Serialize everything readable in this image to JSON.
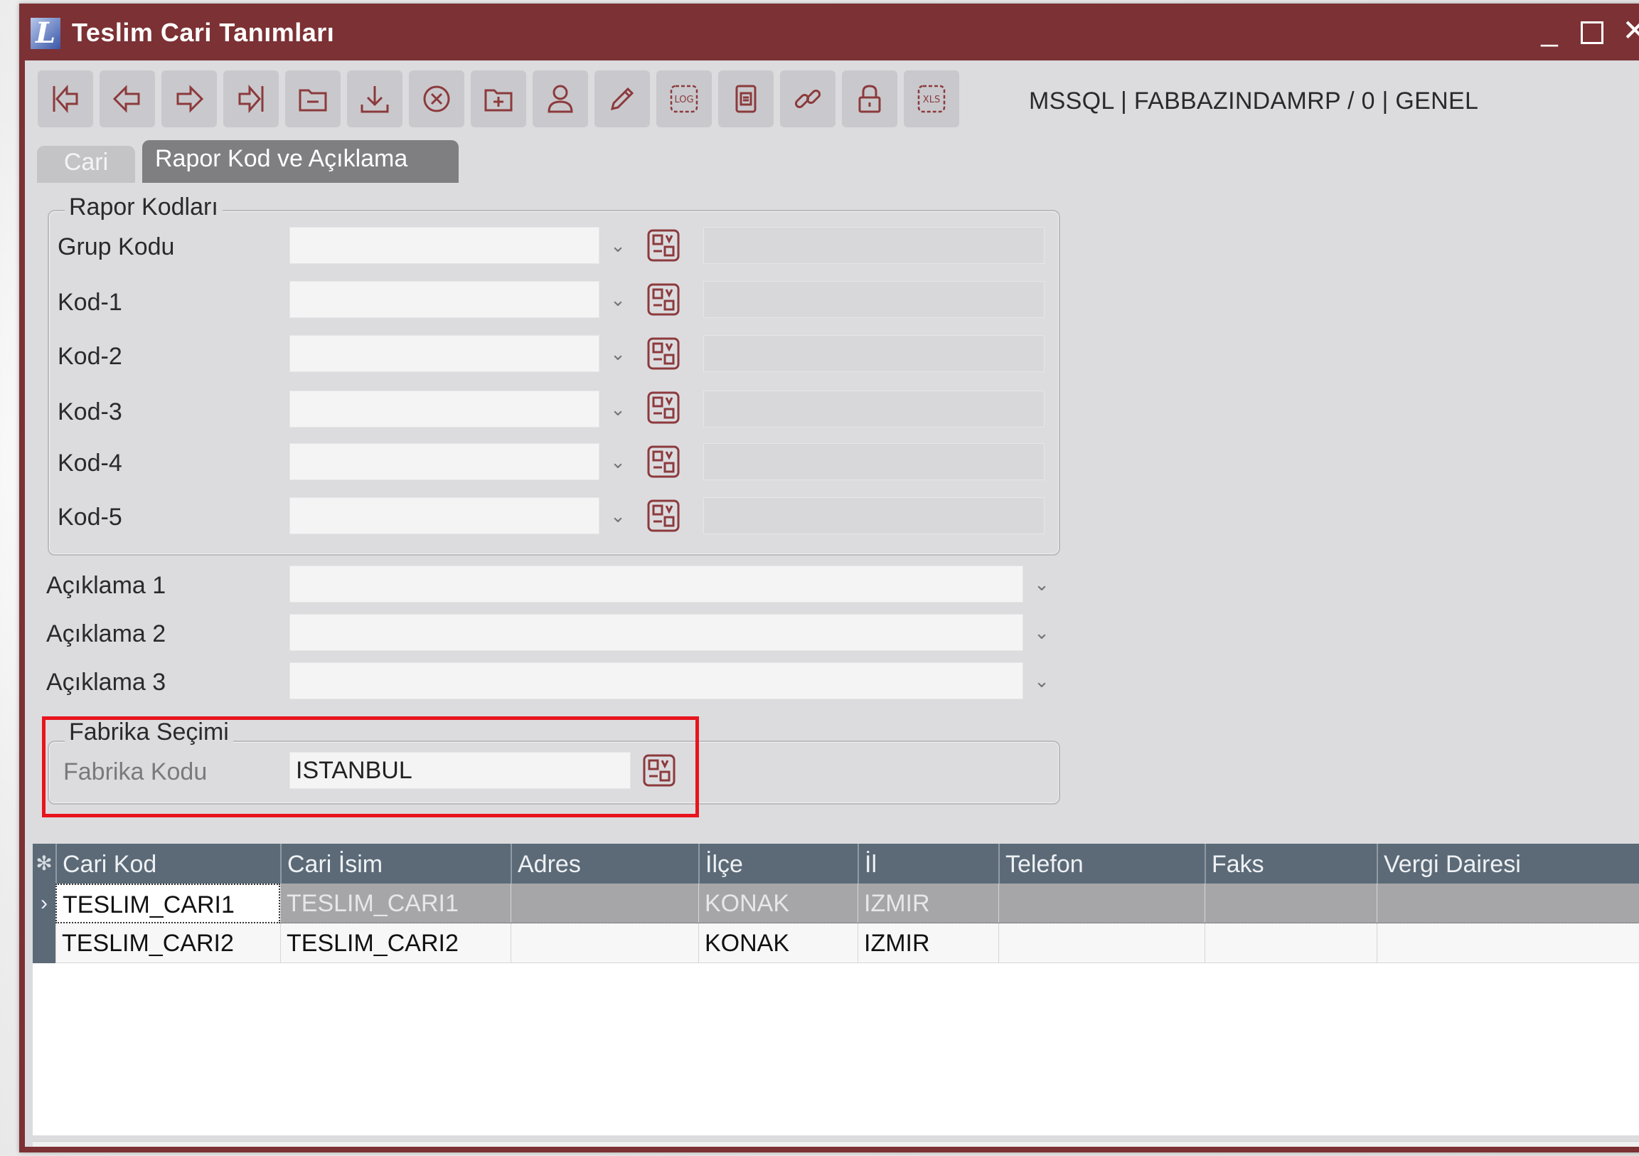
{
  "window": {
    "title": "Teslim Cari Tanımları"
  },
  "toolbar": {
    "buttons": [
      {
        "name": "first-record-button",
        "icon": "first-icon"
      },
      {
        "name": "previous-record-button",
        "icon": "prev-icon"
      },
      {
        "name": "next-record-button",
        "icon": "next-icon"
      },
      {
        "name": "last-record-button",
        "icon": "last-icon"
      },
      {
        "name": "new-record-button",
        "icon": "folder-icon"
      },
      {
        "name": "save-button",
        "icon": "download-icon"
      },
      {
        "name": "delete-button",
        "icon": "cancel-circle-icon"
      },
      {
        "name": "copy-button",
        "icon": "folder-plus-icon"
      },
      {
        "name": "user-button",
        "icon": "user-icon"
      },
      {
        "name": "edit-button",
        "icon": "pencil-icon"
      },
      {
        "name": "log-button",
        "icon": "log-icon",
        "label": "LOG"
      },
      {
        "name": "document-button",
        "icon": "document-icon"
      },
      {
        "name": "link-button",
        "icon": "link-icon"
      },
      {
        "name": "lock-button",
        "icon": "lock-icon"
      },
      {
        "name": "excel-button",
        "icon": "xls-icon",
        "label": "XLS"
      }
    ],
    "connection_info": "MSSQL | FABBAZINDAMRP / 0 | GENEL"
  },
  "tabs": [
    {
      "label": "Cari",
      "active": false
    },
    {
      "label": "Rapor Kod ve Açıklama",
      "active": true
    }
  ],
  "rapor_kodlari": {
    "title": "Rapor Kodları",
    "rows": [
      {
        "label": "Grup Kodu",
        "value": "",
        "description": ""
      },
      {
        "label": "Kod-1",
        "value": "",
        "description": ""
      },
      {
        "label": "Kod-2",
        "value": "",
        "description": ""
      },
      {
        "label": "Kod-3",
        "value": "",
        "description": ""
      },
      {
        "label": "Kod-4",
        "value": "",
        "description": ""
      },
      {
        "label": "Kod-5",
        "value": "",
        "description": ""
      }
    ]
  },
  "aciklamalar": [
    {
      "label": "Açıklama 1",
      "value": ""
    },
    {
      "label": "Açıklama 2",
      "value": ""
    },
    {
      "label": "Açıklama 3",
      "value": ""
    }
  ],
  "fabrika": {
    "title": "Fabrika Seçimi",
    "label": "Fabrika Kodu",
    "value": "ISTANBUL"
  },
  "grid": {
    "columns": [
      "Cari Kod",
      "Cari İsim",
      "Adres",
      "İlçe",
      "İl",
      "Telefon",
      "Faks",
      "Vergi Dairesi"
    ],
    "rows": [
      [
        "TESLIM_CARI1",
        "TESLIM_CARI1",
        "",
        "KONAK",
        "IZMIR",
        "",
        "",
        ""
      ],
      [
        "TESLIM_CARI2",
        "TESLIM_CARI2",
        "",
        "KONAK",
        "IZMIR",
        "",
        "",
        ""
      ]
    ],
    "selected_row": 0
  },
  "colors": {
    "window_frame": "#7c3134",
    "icon_color": "#8c3a3c",
    "grid_header": "#5c6a77",
    "highlight_border": "#e8141e"
  }
}
